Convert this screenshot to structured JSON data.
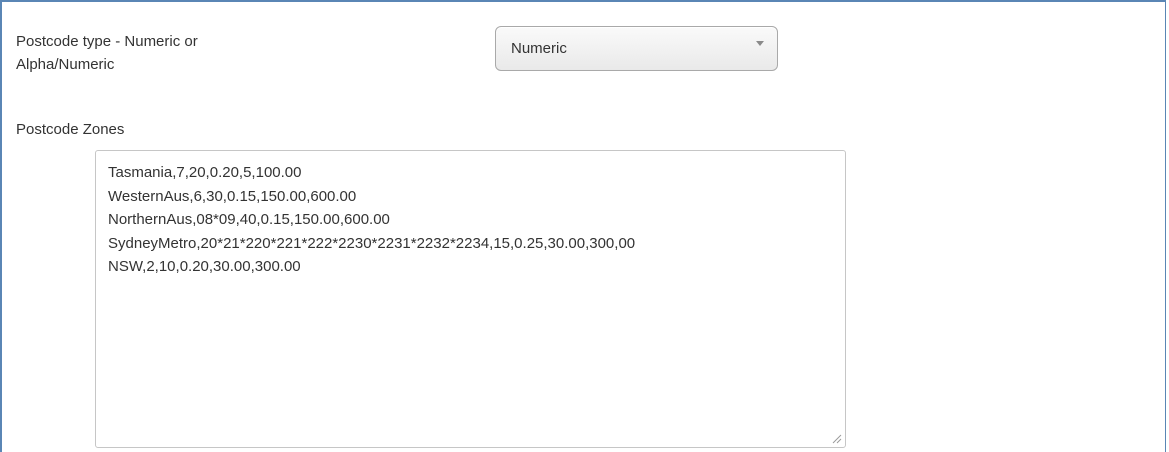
{
  "postcode_type": {
    "label_line1": "Postcode type - Numeric or",
    "label_line2": "Alpha/Numeric",
    "selected_value": "Numeric"
  },
  "postcode_zones": {
    "label": "Postcode Zones",
    "lines": [
      "Tasmania,7,20,0.20,5,100.00",
      "WesternAus,6,30,0.15,150.00,600.00",
      "NorthernAus,08*09,40,0.15,150.00,600.00",
      "SydneyMetro,20*21*220*221*222*2230*2231*2232*2234,15,0.25,30.00,300,00",
      "NSW,2,10,0.20,30.00,300.00"
    ]
  },
  "icons": {
    "dropdown": "chevron-down-icon",
    "resize": "resize-grip-icon"
  },
  "colors": {
    "panel_border": "#5a86b5",
    "text": "#333333"
  }
}
